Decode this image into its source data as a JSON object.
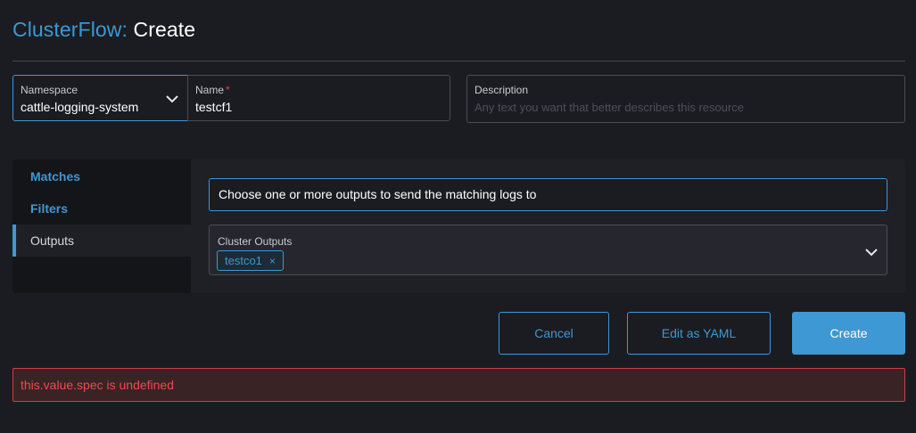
{
  "header": {
    "crumb": "ClusterFlow:",
    "action": "Create"
  },
  "namespace": {
    "label": "Namespace",
    "value": "cattle-logging-system"
  },
  "name": {
    "label": "Name",
    "required_mark": "*",
    "value": "testcf1"
  },
  "description": {
    "label": "Description",
    "placeholder": "Any text you want that better describes this resource"
  },
  "tabs": [
    {
      "label": "Matches"
    },
    {
      "label": "Filters"
    },
    {
      "label": "Outputs"
    }
  ],
  "outputs_panel": {
    "info": "Choose one or more outputs to send the matching logs to",
    "field_label": "Cluster Outputs",
    "selected": [
      {
        "label": "testco1",
        "remove": "×"
      }
    ]
  },
  "buttons": {
    "cancel": "Cancel",
    "edit_yaml": "Edit as YAML",
    "create": "Create"
  },
  "error": "this.value.spec is undefined",
  "colors": {
    "accent": "#3d98d3",
    "error": "#f0494f",
    "background": "#1b1c21"
  },
  "icons": {
    "select_chevron": "chevron-down-icon",
    "chip_remove": "close-icon"
  }
}
